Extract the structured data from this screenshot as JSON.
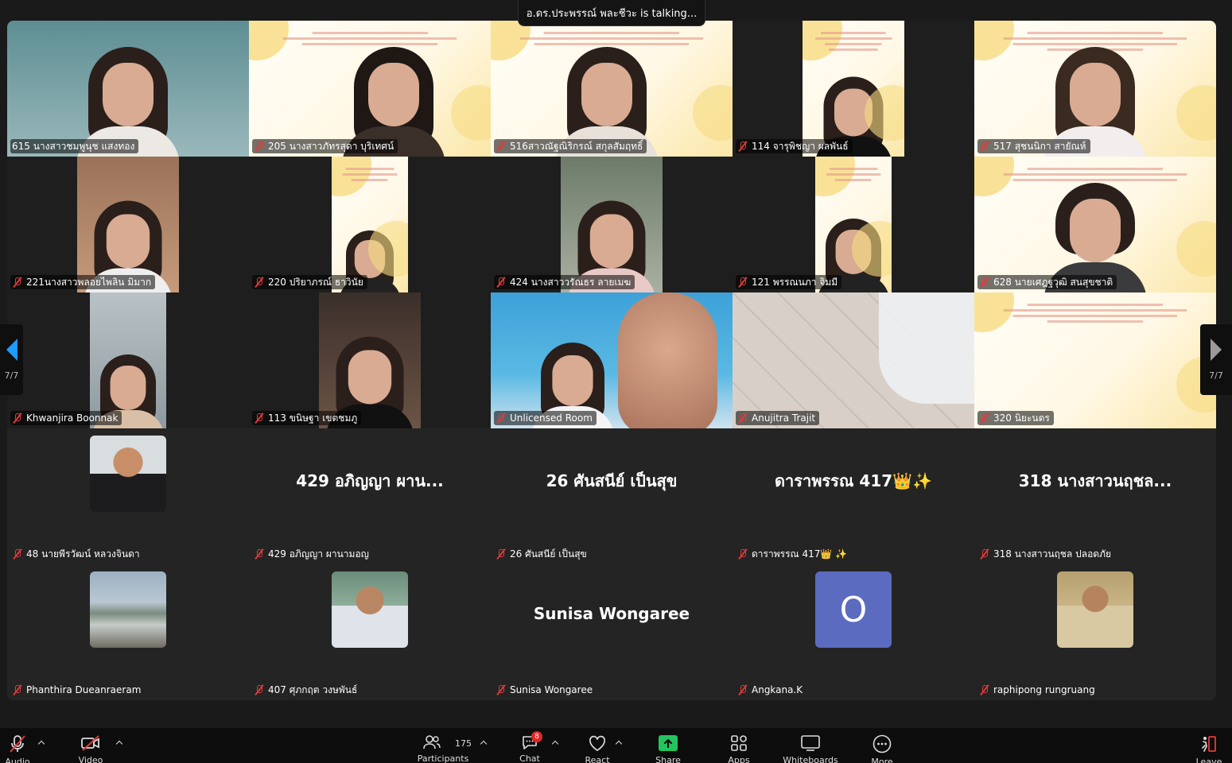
{
  "talking_banner": "อ.ดร.ประพรรณ์ พละชีวะ is talking...",
  "pager": {
    "left_label": "7/7",
    "right_label": "7/7"
  },
  "tiles": [
    {
      "name": "615 นางสาวชมพูนุช แสงทอง"
    },
    {
      "name": "205 นางสาวภัทรสุดา บุริเทศน์"
    },
    {
      "name": "516สาวณัฐณิริกรณ์ สกุลสัมฤทธิ์"
    },
    {
      "name": "114 จารุพิชญา ผลพันธ์"
    },
    {
      "name": "517 สุชนนิกา สายัณห์"
    },
    {
      "name": "221นางสาวพลอยไพลิน มิมาก"
    },
    {
      "name": "220 ปริยาภรณ์ ธาวินัย"
    },
    {
      "name": "424 นางสาววรัณธร ลายเมฆ"
    },
    {
      "name": "121 พรรณนภา จิมมี"
    },
    {
      "name": "628 นายเศฎฐวุฒิ สนสุขชาติ"
    },
    {
      "name": "Khwanjira Boonnak"
    },
    {
      "name": "113 ขนิษฐา เขตชมภู"
    },
    {
      "name": "Unlicensed Room"
    },
    {
      "name": "Anujitra Trajit"
    },
    {
      "name": "320 นิยะนตร"
    },
    {
      "name": "48 นายพีรวัฒน์ หลวงจินดา"
    },
    {
      "name": "429 อภิญญา ผานามอญ",
      "display": "429 อภิญญา ผาน..."
    },
    {
      "name": "26 ศันสนีย์ เป็นสุข",
      "display": "26 ศันสนีย์ เป็นสุข"
    },
    {
      "name": "ดาราพรรณ 417👑 ✨",
      "display": "ดาราพรรณ 417👑✨"
    },
    {
      "name": "318 นางสาวนฤชล ปลอดภัย",
      "display": "318 นางสาวนฤชล..."
    },
    {
      "name": "Phanthira Dueanraeram"
    },
    {
      "name": "407 ศุภกฤต วงษพันธ์"
    },
    {
      "name": "Sunisa Wongaree",
      "display": "Sunisa Wongaree"
    },
    {
      "name": "Angkana.K",
      "avatar_letter": "O"
    },
    {
      "name": "raphipong rungruang"
    }
  ],
  "toolbar": {
    "audio": "Audio",
    "video": "Video",
    "participants": "Participants",
    "participants_count": "175",
    "chat": "Chat",
    "chat_badge": "8",
    "react": "React",
    "share": "Share",
    "apps": "Apps",
    "whiteboards": "Whiteboards",
    "more": "More",
    "leave": "Leave"
  },
  "colors": {
    "mute_red": "#e23b3b",
    "share_green": "#22c55e",
    "pager_blue": "#1e9bff",
    "avatar_purple": "#5a6bc0"
  }
}
